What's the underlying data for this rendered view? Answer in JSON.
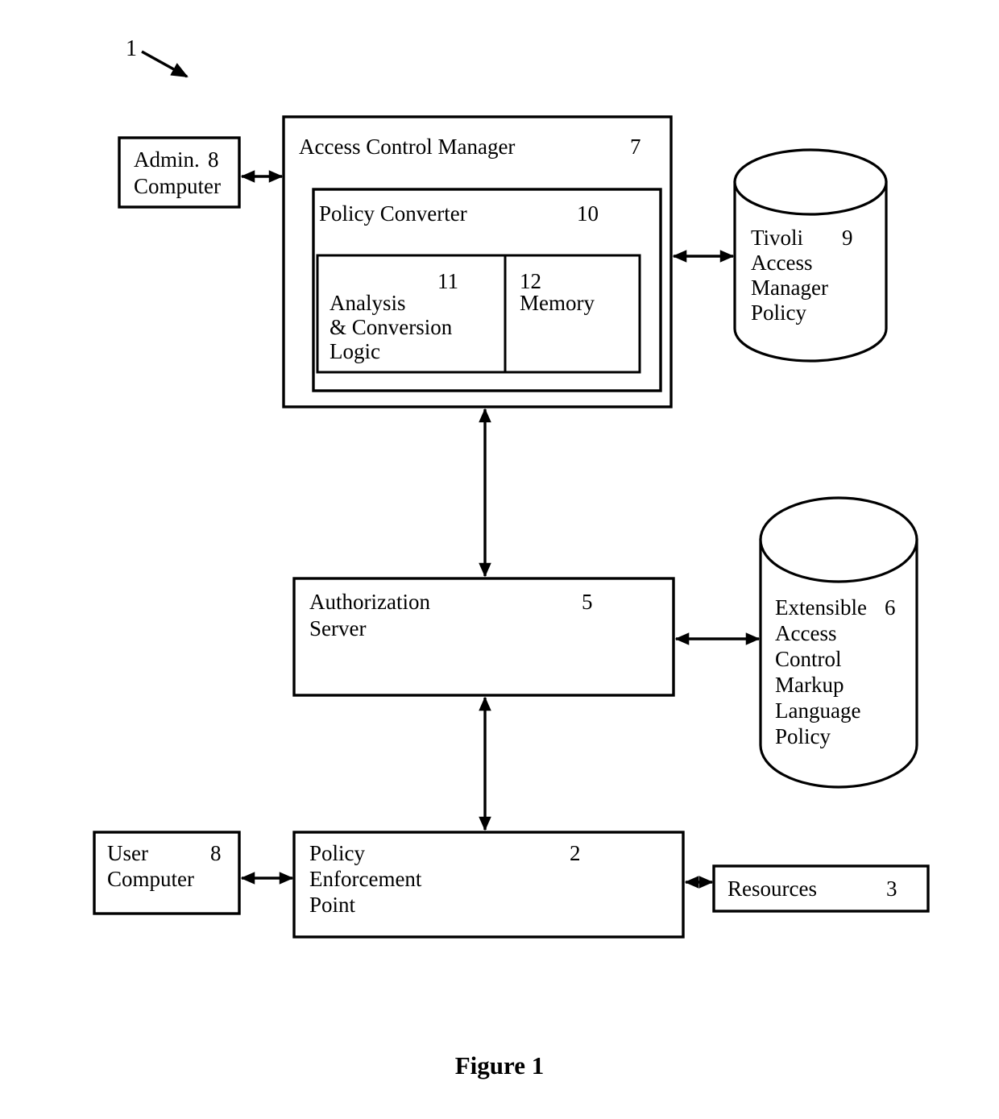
{
  "figure": {
    "caption": "Figure 1",
    "system_ref": "1"
  },
  "blocks": {
    "admin_computer": {
      "line1": "Admin.",
      "line2": "Computer",
      "ref": "8"
    },
    "access_control_manager": {
      "title": "Access Control Manager",
      "ref": "7"
    },
    "policy_converter": {
      "title": "Policy Converter",
      "ref": "10"
    },
    "analysis_conversion_logic": {
      "line1": "Analysis",
      "line2": "& Conversion",
      "line3": "Logic",
      "ref": "11"
    },
    "memory": {
      "title": "Memory",
      "ref": "12"
    },
    "tivoli_policy": {
      "line1": "Tivoli",
      "line2": "Access",
      "line3": "Manager",
      "line4": "Policy",
      "ref": "9"
    },
    "authorization_server": {
      "line1": "Authorization",
      "line2": "Server",
      "ref": "5"
    },
    "xacml_policy": {
      "line1": "Extensible",
      "line2": "Access",
      "line3": "Control",
      "line4": "Markup",
      "line5": "Language",
      "line6": "Policy",
      "ref": "6"
    },
    "user_computer": {
      "line1": "User",
      "line2": "Computer",
      "ref": "8"
    },
    "policy_enforcement_point": {
      "line1": "Policy",
      "line2": "Enforcement",
      "line3": "Point",
      "ref": "2"
    },
    "resources": {
      "title": "Resources",
      "ref": "3"
    }
  },
  "style": {
    "stroke": "#000000",
    "fill": "#ffffff"
  }
}
